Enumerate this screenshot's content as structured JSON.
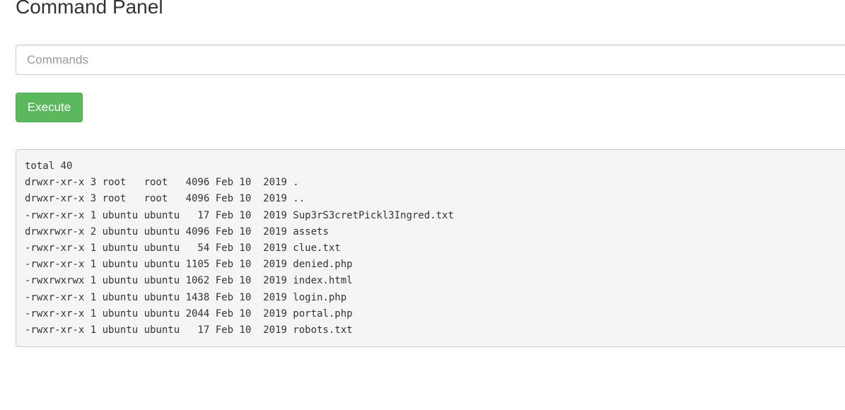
{
  "header": {
    "title": "Command Panel"
  },
  "command_form": {
    "input_placeholder": "Commands",
    "input_value": "",
    "execute_label": "Execute"
  },
  "output": {
    "lines": [
      "total 40",
      "drwxr-xr-x 3 root   root   4096 Feb 10  2019 .",
      "drwxr-xr-x 3 root   root   4096 Feb 10  2019 ..",
      "-rwxr-xr-x 1 ubuntu ubuntu   17 Feb 10  2019 Sup3rS3cretPickl3Ingred.txt",
      "drwxrwxr-x 2 ubuntu ubuntu 4096 Feb 10  2019 assets",
      "-rwxr-xr-x 1 ubuntu ubuntu   54 Feb 10  2019 clue.txt",
      "-rwxr-xr-x 1 ubuntu ubuntu 1105 Feb 10  2019 denied.php",
      "-rwxrwxrwx 1 ubuntu ubuntu 1062 Feb 10  2019 index.html",
      "-rwxr-xr-x 1 ubuntu ubuntu 1438 Feb 10  2019 login.php",
      "-rwxr-xr-x 1 ubuntu ubuntu 2044 Feb 10  2019 portal.php",
      "-rwxr-xr-x 1 ubuntu ubuntu   17 Feb 10  2019 robots.txt"
    ]
  },
  "colors": {
    "execute_button": "#5cb85c",
    "output_background": "#f5f5f5",
    "text": "#333333"
  }
}
